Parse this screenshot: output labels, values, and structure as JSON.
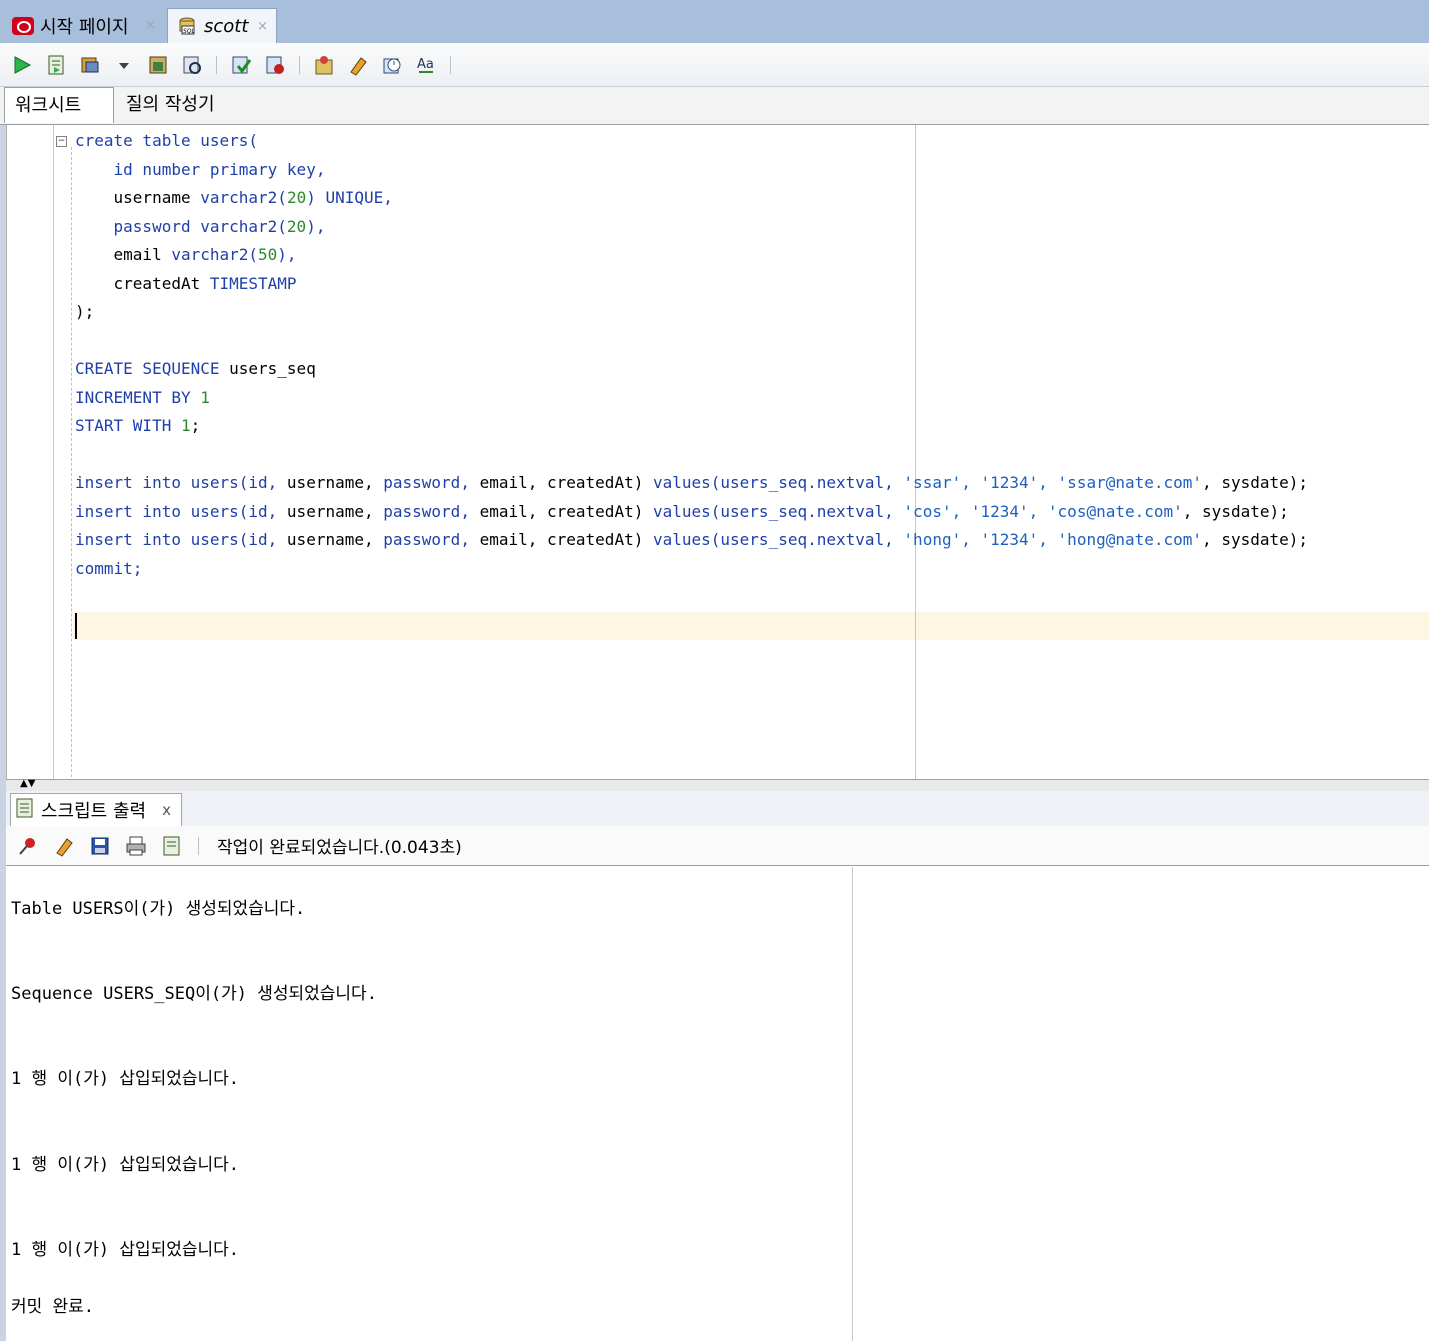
{
  "tabs": [
    {
      "label": "시작 페이지",
      "icon": "oracle-icon",
      "close": "×"
    },
    {
      "label": "scott",
      "icon": "sql-connection-icon",
      "close": "×"
    }
  ],
  "toolbar": {
    "icons": [
      "run-statement-icon",
      "run-script-icon",
      "autotrace-icon",
      "dropdown-icon",
      "explain-plan-icon",
      "sql-tuning-icon",
      "commit-icon",
      "rollback-icon",
      "unshared-sql-icon",
      "clear-icon",
      "sql-history-icon",
      "format-icon"
    ]
  },
  "subtabs": [
    "워크시트",
    "질의 작성기"
  ],
  "editor": {
    "fold": "−",
    "lines": [
      [
        {
          "t": "create table users(",
          "c": "kw"
        }
      ],
      [
        {
          "t": "    id number primary key,",
          "c": "kw"
        }
      ],
      [
        {
          "t": "    username ",
          "c": "plain"
        },
        {
          "t": "varchar2(",
          "c": "kw"
        },
        {
          "t": "20",
          "c": "num"
        },
        {
          "t": ") UNIQUE,",
          "c": "kw"
        }
      ],
      [
        {
          "t": "    password varchar2(",
          "c": "kw"
        },
        {
          "t": "20",
          "c": "num"
        },
        {
          "t": "),",
          "c": "kw"
        }
      ],
      [
        {
          "t": "    email ",
          "c": "plain"
        },
        {
          "t": "varchar2(",
          "c": "kw"
        },
        {
          "t": "50",
          "c": "num"
        },
        {
          "t": "),",
          "c": "kw"
        }
      ],
      [
        {
          "t": "    createdAt ",
          "c": "plain"
        },
        {
          "t": "TIMESTAMP",
          "c": "kw"
        }
      ],
      [
        {
          "t": ");",
          "c": "plain"
        }
      ],
      [
        {
          "t": "",
          "c": "plain"
        }
      ],
      [
        {
          "t": "CREATE SEQUENCE ",
          "c": "kw"
        },
        {
          "t": "users_seq",
          "c": "plain"
        }
      ],
      [
        {
          "t": "INCREMENT BY ",
          "c": "kw"
        },
        {
          "t": "1",
          "c": "num"
        }
      ],
      [
        {
          "t": "START WITH ",
          "c": "kw"
        },
        {
          "t": "1",
          "c": "num"
        },
        {
          "t": ";",
          "c": "plain"
        }
      ],
      [
        {
          "t": "",
          "c": "plain"
        }
      ],
      [
        {
          "t": "insert into users(id, ",
          "c": "kw"
        },
        {
          "t": "username, ",
          "c": "plain"
        },
        {
          "t": "password, ",
          "c": "kw"
        },
        {
          "t": "email, createdAt) ",
          "c": "plain"
        },
        {
          "t": "values(users_seq.nextval, ",
          "c": "kw"
        },
        {
          "t": "'ssar', '1234', 'ssar@nate.com'",
          "c": "str"
        },
        {
          "t": ", sysdate);",
          "c": "plain"
        }
      ],
      [
        {
          "t": "insert into users(id, ",
          "c": "kw"
        },
        {
          "t": "username, ",
          "c": "plain"
        },
        {
          "t": "password, ",
          "c": "kw"
        },
        {
          "t": "email, createdAt) ",
          "c": "plain"
        },
        {
          "t": "values(users_seq.nextval, ",
          "c": "kw"
        },
        {
          "t": "'cos', '1234', 'cos@nate.com'",
          "c": "str"
        },
        {
          "t": ", sysdate);",
          "c": "plain"
        }
      ],
      [
        {
          "t": "insert into users(id, ",
          "c": "kw"
        },
        {
          "t": "username, ",
          "c": "plain"
        },
        {
          "t": "password, ",
          "c": "kw"
        },
        {
          "t": "email, createdAt) ",
          "c": "plain"
        },
        {
          "t": "values(users_seq.nextval, ",
          "c": "kw"
        },
        {
          "t": "'hong', '1234', 'hong@nate.com'",
          "c": "str"
        },
        {
          "t": ", sysdate);",
          "c": "plain"
        }
      ],
      [
        {
          "t": "commit;",
          "c": "kw"
        }
      ]
    ]
  },
  "splitter": {
    "arrows": "▲▼"
  },
  "output_panel": {
    "tab_label": "스크립트 출력",
    "tab_close": "x",
    "status": "작업이 완료되었습니다.(0.043초)",
    "lines": [
      "Table USERS이(가) 생성되었습니다.",
      "Sequence USERS_SEQ이(가) 생성되었습니다.",
      "1 행 이(가) 삽입되었습니다.",
      "1 행 이(가) 삽입되었습니다.",
      "1 행 이(가) 삽입되었습니다.",
      "커밋 완료."
    ]
  }
}
